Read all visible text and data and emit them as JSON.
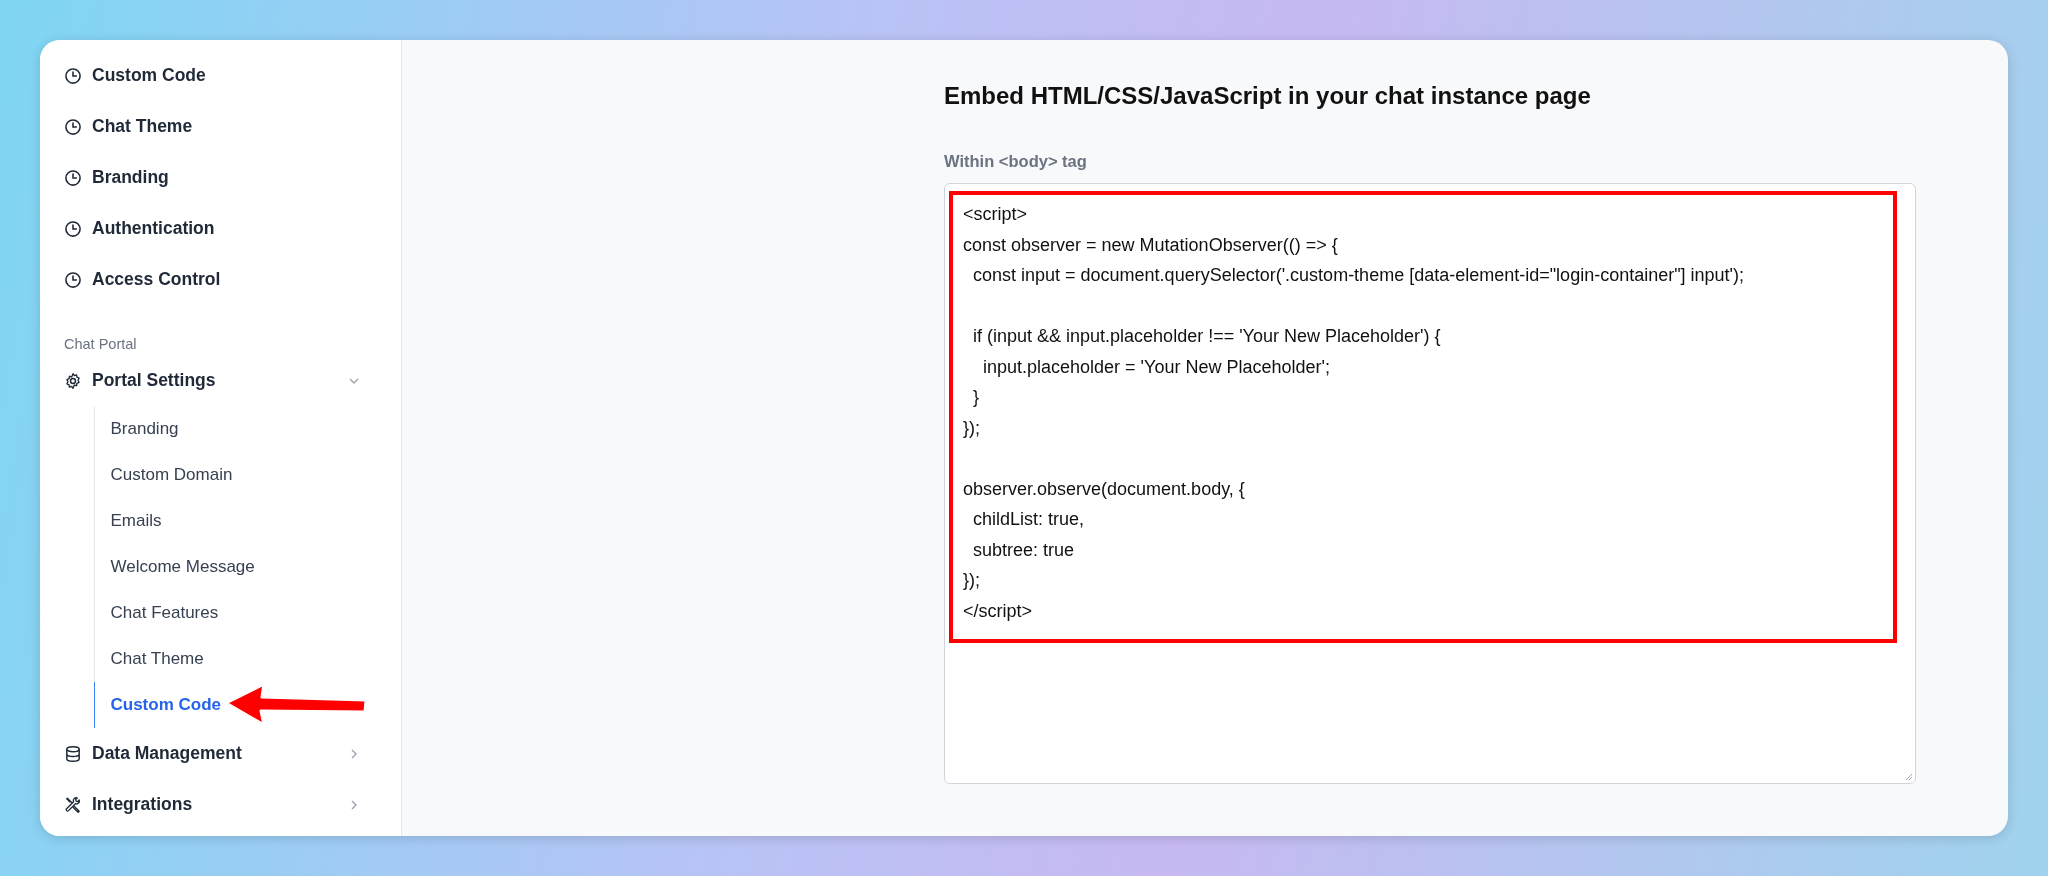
{
  "sidebar": {
    "top_items": [
      {
        "label": "Custom Code"
      },
      {
        "label": "Chat Theme"
      },
      {
        "label": "Branding"
      },
      {
        "label": "Authentication"
      },
      {
        "label": "Access Control"
      }
    ],
    "section": {
      "title": "Chat Portal",
      "items": [
        {
          "label": "Portal Settings",
          "expanded": true,
          "children": [
            {
              "label": "Branding",
              "selected": false
            },
            {
              "label": "Custom Domain",
              "selected": false
            },
            {
              "label": "Emails",
              "selected": false
            },
            {
              "label": "Welcome Message",
              "selected": false
            },
            {
              "label": "Chat Features",
              "selected": false
            },
            {
              "label": "Chat Theme",
              "selected": false
            },
            {
              "label": "Custom Code",
              "selected": true
            }
          ]
        },
        {
          "label": "Data Management",
          "expanded": false
        },
        {
          "label": "Integrations",
          "expanded": false
        }
      ]
    }
  },
  "main": {
    "heading": "Embed HTML/CSS/JavaScript in your chat instance page",
    "field_label": "Within <body> tag",
    "code": {
      "value": "<script>\nconst observer = new MutationObserver(() => {\n  const input = document.querySelector('.custom-theme [data-element-id=\"login-container\"] input');\n\n  if (input && input.placeholder !== 'Your New Placeholder') {\n    input.placeholder = 'Your New Placeholder';\n  }\n});\n\nobserver.observe(document.body, {\n  childList: true,\n  subtree: true\n});\n</script>"
    }
  }
}
